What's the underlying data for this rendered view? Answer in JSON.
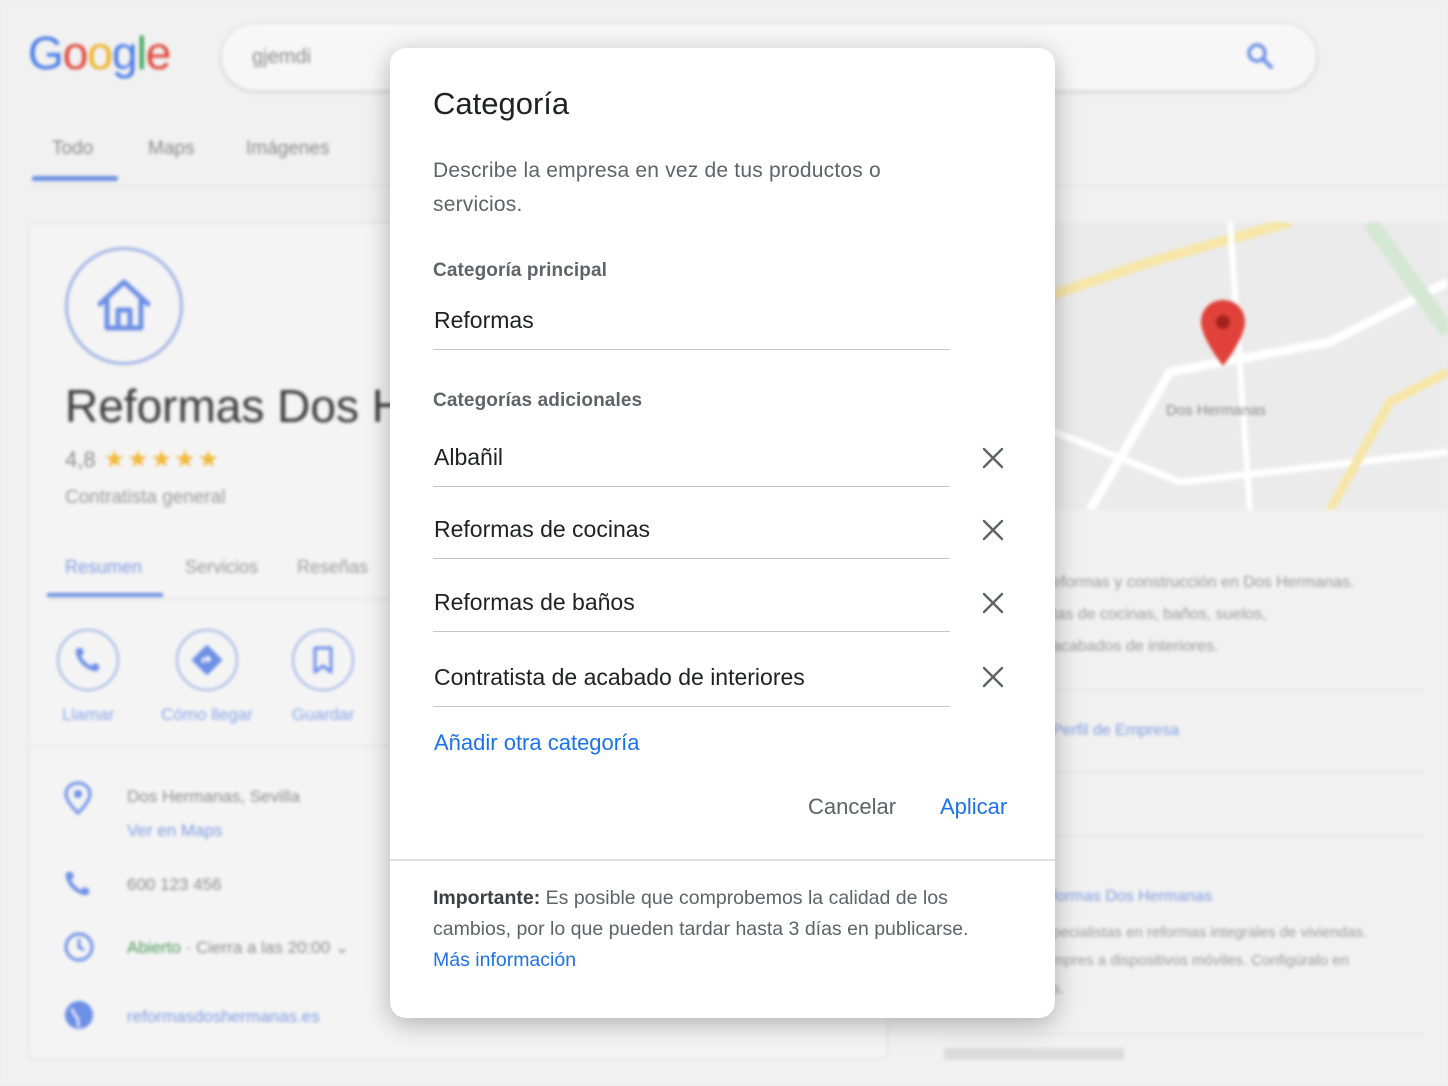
{
  "background": {
    "search_query": "gjemdi",
    "top_tabs": [
      "Todo",
      "Maps",
      "Imágenes"
    ],
    "business": {
      "name": "Reformas Dos H",
      "rating": "4,8",
      "stars": "★★★★★",
      "type": "Contratista general",
      "tabs": [
        "Resumen",
        "Servicios",
        "Reseñas"
      ],
      "actions": [
        "Llamar",
        "Cómo llegar",
        "Guardar"
      ],
      "address": "Dos Hermanas, Sevilla",
      "map_link": "Ver en Maps",
      "phone": "600 123 456",
      "hours_status": "Abierto",
      "hours_detail": "· Cierra a las 20:00",
      "website": "reformasdoshermanas.es"
    },
    "map_label": "Dos Hermanas",
    "right_column": {
      "desc_lines": [
        "eformas y construcción en Dos Hermanas.",
        "tas de cocinas, baños, suelos,",
        "acabados de interiores."
      ],
      "profile_link": "Perfil de Empresa",
      "post_title": "formas Dos Hermanas",
      "post_lines": [
        "pecialistas en reformas integrales de viviendas.",
        "mpres a dispositivos móviles. Configúralo en",
        "s."
      ]
    }
  },
  "modal": {
    "title": "Categoría",
    "description": "Describe la empresa en vez de tus productos o servicios.",
    "primary_label": "Categoría principal",
    "primary_value": "Reformas",
    "additional_label": "Categorías adicionales",
    "additional": [
      {
        "value": "Albañil"
      },
      {
        "value": "Reformas de cocinas"
      },
      {
        "value": "Reformas de baños"
      },
      {
        "value": "Contratista de acabado de interiores"
      }
    ],
    "add_label": "Añadir otra categoría",
    "cancel_label": "Cancelar",
    "apply_label": "Aplicar",
    "note_bold": "Importante:",
    "note_text": " Es posible que comprobemos la calidad de los cambios, por lo que pueden tardar hasta 3 días en publicarse. ",
    "note_link": "Más información"
  },
  "colors": {
    "accent": "#1a73e8",
    "text_primary": "#202124",
    "text_secondary": "#5f6368",
    "star": "#f2b93b",
    "map_pin": "#e0413a"
  }
}
